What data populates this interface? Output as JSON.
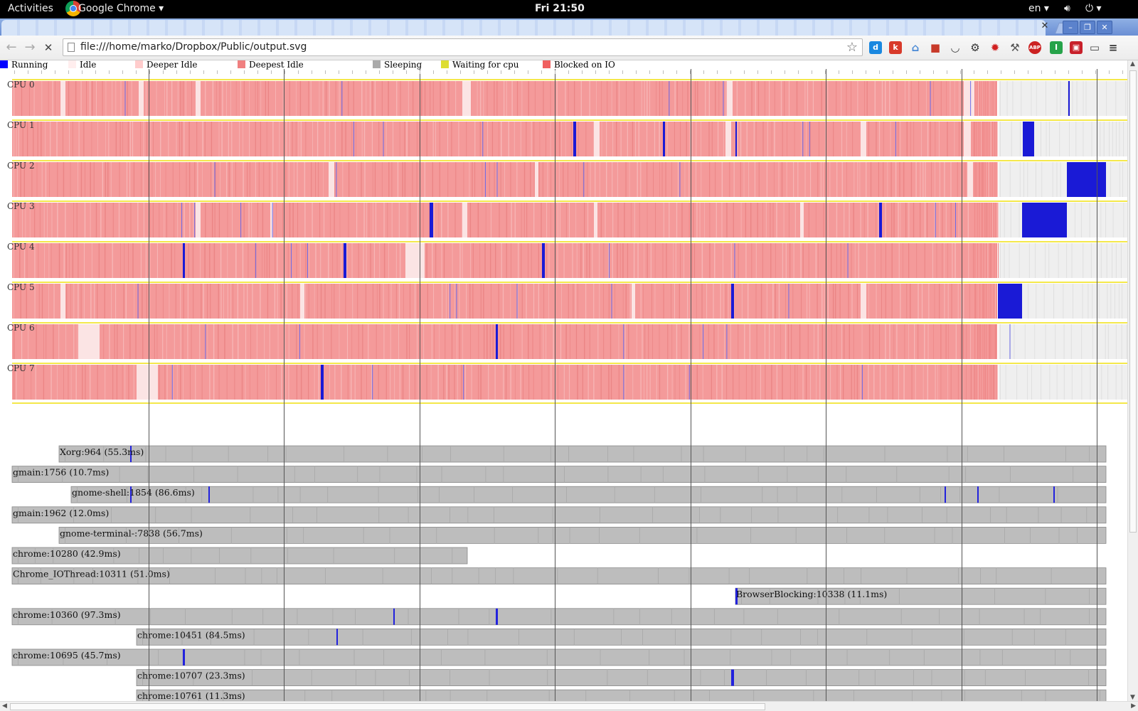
{
  "gnome_panel": {
    "activities": "Activities",
    "app_menu": "Google Chrome ▾",
    "clock": "Fri 21:50",
    "language": "en ▾",
    "volume_icon": "volume-icon",
    "power_icon": "power-icon"
  },
  "browser": {
    "tab_close": "✕",
    "window_buttons": [
      "–",
      "❐",
      "✕"
    ],
    "back_glyph": "←",
    "forward_glyph": "→",
    "stop_glyph": "✕",
    "url": "file:///home/marko/Dropbox/Public/output.svg",
    "extensions": [
      {
        "name": "dashlane-icon",
        "glyph": "d",
        "color": "#1a88e0"
      },
      {
        "name": "k-extension-icon",
        "glyph": "k",
        "color": "#d83a2a"
      },
      {
        "name": "screenshot-icon",
        "glyph": "⌂",
        "color": "#4a8ad6"
      },
      {
        "name": "bookmark-icon",
        "glyph": "■",
        "color": "#c83a2a"
      },
      {
        "name": "pocket-icon",
        "glyph": "◡",
        "color": "#444"
      },
      {
        "name": "settings-gear-icon",
        "glyph": "⚙",
        "color": "#333"
      },
      {
        "name": "bug-icon",
        "glyph": "✹",
        "color": "#d02020"
      },
      {
        "name": "wrench-icon",
        "glyph": "⚒",
        "color": "#555"
      },
      {
        "name": "adblock-plus-icon",
        "glyph": "ABP",
        "color": "#cc2222"
      },
      {
        "name": "green-extension-icon",
        "glyph": "I",
        "color": "#27a34a"
      },
      {
        "name": "red-extension-icon",
        "glyph": "▣",
        "color": "#c8202a"
      },
      {
        "name": "cast-icon",
        "glyph": "▭",
        "color": "#444"
      },
      {
        "name": "menu-icon",
        "glyph": "≡",
        "color": "#333"
      }
    ]
  },
  "legend": [
    {
      "label": "Running",
      "color": "#0000ff"
    },
    {
      "label": "Idle",
      "color": "#ffeeee"
    },
    {
      "label": "Deeper Idle",
      "color": "#ffcccc"
    },
    {
      "label": "Deepest Idle",
      "color": "#f08080"
    },
    {
      "label": "Sleeping",
      "color": "#aaaaaa"
    },
    {
      "label": "Waiting for cpu",
      "color": "#dddd33"
    },
    {
      "label": "Blocked on IO",
      "color": "#f06060"
    }
  ],
  "cpus": [
    {
      "label": "CPU 0",
      "idle_gaps": [
        [
          85,
          92
        ],
        [
          195,
          202
        ],
        [
          275,
          282
        ],
        [
          650,
          662
        ],
        [
          1022,
          1030
        ],
        [
          1355,
          1370
        ]
      ],
      "running": [
        [
          1502,
          1504
        ]
      ]
    },
    {
      "label": "CPU 1",
      "idle_gaps": [
        [
          835,
          843
        ],
        [
          1020,
          1028
        ],
        [
          1210,
          1218
        ],
        [
          1355,
          1365
        ]
      ],
      "running": [
        [
          806,
          810
        ],
        [
          932,
          935
        ],
        [
          1034,
          1036
        ],
        [
          1438,
          1454
        ]
      ]
    },
    {
      "label": "CPU 2",
      "idle_gaps": [
        [
          462,
          470
        ],
        [
          752,
          757
        ],
        [
          1360,
          1368
        ]
      ],
      "running": [
        [
          1500,
          1555
        ]
      ]
    },
    {
      "label": "CPU 3",
      "idle_gaps": [
        [
          275,
          282
        ],
        [
          380,
          384
        ],
        [
          650,
          657
        ],
        [
          835,
          840
        ],
        [
          1125,
          1130
        ]
      ],
      "running": [
        [
          604,
          609
        ],
        [
          1236,
          1240
        ],
        [
          1437,
          1500
        ]
      ]
    },
    {
      "label": "CPU 4",
      "idle_gaps": [
        [
          570,
          597
        ]
      ],
      "running": [
        [
          257,
          260
        ],
        [
          483,
          487
        ],
        [
          762,
          766
        ]
      ]
    },
    {
      "label": "CPU 5",
      "idle_gaps": [
        [
          85,
          92
        ],
        [
          422,
          428
        ],
        [
          888,
          893
        ],
        [
          1210,
          1218
        ]
      ],
      "running": [
        [
          1028,
          1032
        ],
        [
          1403,
          1437
        ]
      ]
    },
    {
      "label": "CPU 6",
      "idle_gaps": [
        [
          110,
          140
        ]
      ],
      "running": [
        [
          697,
          700
        ]
      ]
    },
    {
      "label": "CPU 7",
      "idle_gaps": [
        [
          192,
          222
        ]
      ],
      "running": [
        [
          451,
          455
        ]
      ]
    }
  ],
  "processes": [
    {
      "label": "Xorg:964 (55.3ms)",
      "start": 83,
      "end": 1555,
      "running": [
        [
          183,
          185
        ]
      ]
    },
    {
      "label": "gmain:1756 (10.7ms)",
      "start": 17,
      "end": 1555,
      "running": []
    },
    {
      "label": "gnome-shell:1854 (86.6ms)",
      "start": 100,
      "end": 1555,
      "running": [
        [
          183,
          185
        ],
        [
          293,
          295
        ],
        [
          1328,
          1330
        ],
        [
          1374,
          1376
        ],
        [
          1481,
          1483
        ]
      ]
    },
    {
      "label": "gmain:1962 (12.0ms)",
      "start": 17,
      "end": 1555,
      "running": []
    },
    {
      "label": "gnome-terminal-:7838 (56.7ms)",
      "start": 83,
      "end": 1555,
      "running": []
    },
    {
      "label": "chrome:10280 (42.9ms)",
      "start": 17,
      "end": 657,
      "running": []
    },
    {
      "label": "Chrome_IOThread:10311 (51.0ms)",
      "start": 17,
      "end": 1555,
      "running": []
    },
    {
      "label": "BrowserBlocking:10338 (11.1ms)",
      "start": 1034,
      "end": 1555,
      "running": [
        [
          1034,
          1037
        ]
      ]
    },
    {
      "label": "chrome:10360 (97.3ms)",
      "start": 17,
      "end": 1555,
      "running": [
        [
          553,
          555
        ],
        [
          697,
          700
        ]
      ]
    },
    {
      "label": "chrome:10451 (84.5ms)",
      "start": 192,
      "end": 1555,
      "running": [
        [
          473,
          475
        ]
      ]
    },
    {
      "label": "chrome:10695 (45.7ms)",
      "start": 17,
      "end": 1555,
      "running": [
        [
          257,
          260
        ]
      ]
    },
    {
      "label": "chrome:10707 (23.3ms)",
      "start": 192,
      "end": 1555,
      "running": [
        [
          1028,
          1032
        ]
      ]
    },
    {
      "label": "chrome:10761 (11.3ms)",
      "start": 192,
      "end": 1555,
      "running": []
    }
  ]
}
